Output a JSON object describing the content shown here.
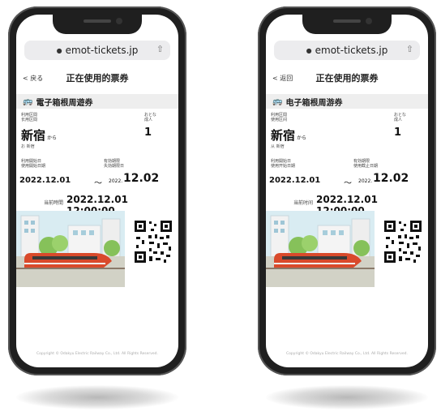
{
  "url": "emot-tickets.jp",
  "screens": [
    {
      "back_label": "戻る",
      "page_title": "正在使用的票券",
      "ticket_name": "電子箱根周遊券",
      "area_label_1": "利用区間",
      "area_label_2": "长用区間",
      "passenger_label_1": "おとな",
      "passenger_label_2": "成人",
      "station": "新宿",
      "from_suffix": "から",
      "station_roman": "お 新宿",
      "count": "1",
      "start_label_1": "利用開始日",
      "start_label_2": "使用開始日期",
      "end_label_1": "有効期限",
      "end_label_2": "失効期限日",
      "start_date": "2022.12.01",
      "tilde": "～",
      "end_year": "2022.",
      "end_md": "12.02",
      "now_label": "当前時間",
      "now": "2022.12.01 12:00:00",
      "copyright": "Copyright © Odakyu Electric Railway Co., Ltd. All Rights Reserved."
    },
    {
      "back_label": "返回",
      "page_title": "正在使用的票券",
      "ticket_name": "电子箱根周游券",
      "area_label_1": "利用区間",
      "area_label_2": "使用区间",
      "passenger_label_1": "おとな",
      "passenger_label_2": "成人",
      "station": "新宿",
      "from_suffix": "から",
      "station_roman": "从 新宿",
      "count": "1",
      "start_label_1": "利用開始日",
      "start_label_2": "使用开始日期",
      "end_label_1": "有効期限",
      "end_label_2": "使用截止日期",
      "start_date": "2022.12.01",
      "tilde": "～",
      "end_year": "2022.",
      "end_md": "12.02",
      "now_label": "当前时间",
      "now": "2022.12.01 12:00:00",
      "copyright": "Copyright © Odakyu Electric Railway Co., Ltd. All Rights Reserved."
    }
  ],
  "icons": {
    "lock": "lock-icon",
    "share": "share-icon",
    "back": "chevron-left-icon",
    "bus": "bus-icon",
    "qr": "qr-code-icon"
  },
  "colors": {
    "train": "#d94a2b",
    "sky": "#cfe6ef",
    "tree": "#7fbf4d",
    "ground": "#cfcfc4"
  }
}
